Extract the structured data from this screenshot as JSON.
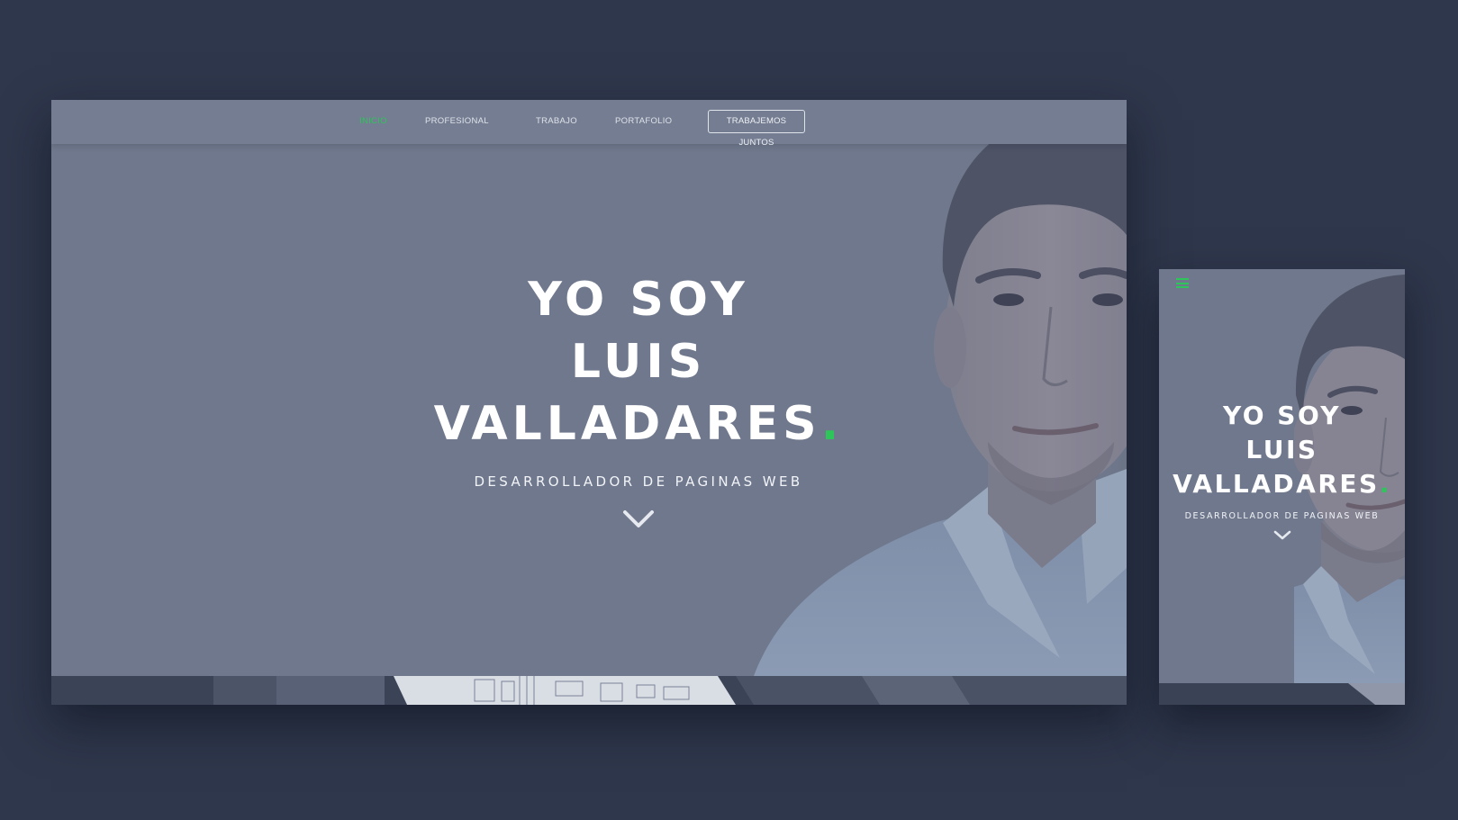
{
  "colors": {
    "background": "#2f374c",
    "overlay": "#6f788c",
    "accent": "#2ec55a",
    "text": "#ffffff"
  },
  "desktop": {
    "nav": {
      "items": [
        {
          "label": "INICIO",
          "active": true
        },
        {
          "label": "PROFESIONAL",
          "active": false
        },
        {
          "label": "TRABAJO",
          "active": false
        },
        {
          "label": "PORTAFOLIO",
          "active": false
        }
      ],
      "cta_label": "TRABAJEMOS JUNTOS"
    },
    "hero": {
      "line1": "YO SOY",
      "line2": "LUIS",
      "line3": "VALLADARES",
      "dot": ".",
      "subtitle": "DESARROLLADOR DE PAGINAS WEB",
      "scroll_icon": "chevron-down-icon"
    }
  },
  "mobile": {
    "menu_icon": "hamburger-icon",
    "hero": {
      "line1": "YO SOY",
      "line2": "LUIS",
      "line3": "VALLADARES",
      "dot": ".",
      "subtitle": "DESARROLLADOR DE PAGINAS WEB",
      "scroll_icon": "chevron-down-icon"
    }
  }
}
